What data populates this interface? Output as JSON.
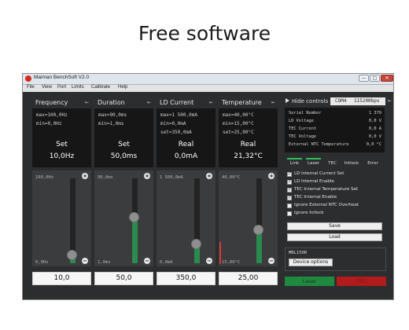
{
  "heading": "Free software",
  "window": {
    "title": "Maiman BenchSoft V2.0",
    "controls": {
      "minimize": "—",
      "maximize": "□",
      "close": "✕"
    }
  },
  "menu": [
    "File",
    "View",
    "Port",
    "Limits",
    "Calibrate",
    "Help"
  ],
  "panels": [
    {
      "title": "Frequency",
      "info": [
        "max=100,0Hz",
        "min=0,0Hz"
      ],
      "mode": "Set",
      "display": "10,0Hz",
      "slider_max": "100,0Hz",
      "slider_min": "0,0Hz",
      "value": "10,0",
      "level": 0.1
    },
    {
      "title": "Duration",
      "info": [
        "max=90,0ms",
        "min=1,0ms"
      ],
      "mode": "Set",
      "display": "50,0ms",
      "slider_max": "90,0ms",
      "slider_min": "1,0ms",
      "value": "50,0",
      "level": 0.55
    },
    {
      "title": "LD Current",
      "info": [
        "max=1 500,0mA",
        "min=0,0mA",
        "set=350,0mA"
      ],
      "mode": "Real",
      "display": "0,0mA",
      "slider_max": "1 500,0mA",
      "slider_min": "0,0mA",
      "value": "350,0",
      "level": 0.23
    },
    {
      "title": "Temperature",
      "info": [
        "max=40,00°C",
        "min=15,00°C",
        "set=25,00°C"
      ],
      "mode": "Real",
      "display": "21,32°C",
      "slider_max": "40,00°C",
      "slider_min": "15,00°C",
      "value": "25,00",
      "level": 0.4
    }
  ],
  "right_panel": {
    "toggle_label": "Hide controls",
    "port": "COM4",
    "baud": "115200bps",
    "status": [
      {
        "label": "Serial Number",
        "value": "1 379"
      },
      {
        "label": "LD Voltage",
        "value": "0,0  V"
      },
      {
        "label": "TEC Current",
        "value": "0,0  A"
      },
      {
        "label": "TEC Voltage",
        "value": "0,0  V"
      },
      {
        "label": "External NTC Temperature",
        "value": "0,0  °C"
      }
    ],
    "indicators": [
      {
        "label": "Link",
        "active": true
      },
      {
        "label": "Laser",
        "active": true
      },
      {
        "label": "TEC",
        "active": false
      },
      {
        "label": "Intlock",
        "active": false
      },
      {
        "label": "Error",
        "active": false
      }
    ],
    "checkboxes": [
      {
        "label": "LD Internal Current Set",
        "checked": true
      },
      {
        "label": "LD Internal Enable",
        "checked": true
      },
      {
        "label": "TEC Internal Temperature Set",
        "checked": true
      },
      {
        "label": "TEC Internal Enable",
        "checked": true
      },
      {
        "label": "Ignore External NTC Overheat",
        "checked": false
      },
      {
        "label": "Ignore Intlock",
        "checked": false
      }
    ],
    "save_label": "Save",
    "load_label": "Load",
    "model": "MBL150R",
    "device_options_label": "Device options",
    "laser_label": "Laser",
    "tec_label": "TEC",
    "colors": {
      "laser_on": "#1d8a3f",
      "tec_off": "#b11b1b",
      "indicator": "#2bbf58",
      "slider_fill": "#2a8a4f"
    }
  }
}
